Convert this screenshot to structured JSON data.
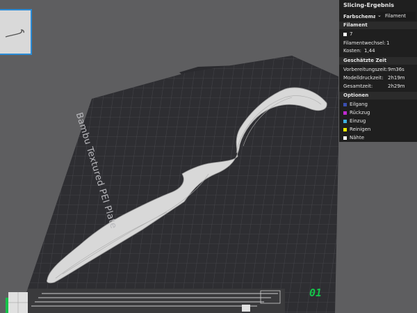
{
  "panel": {
    "title": "Slicing-Ergebnis",
    "scheme_label": "Farbschema",
    "scheme_value": "Filament",
    "filament_header": "Filament",
    "filament_number": "7",
    "filament_changes_label": "Filamentwechsel:",
    "filament_changes_value": "1",
    "cost_label": "Kosten:",
    "cost_value": "1,44",
    "time_header": "Geschätzte Zeit",
    "prep_label": "Vorbereitungszeit:",
    "prep_value": "9m36s",
    "model_label": "Modelldruckzeit:",
    "model_value": "2h19m",
    "total_label": "Gesamtzeit:",
    "total_value": "2h29m",
    "options_header": "Optionen",
    "options": [
      {
        "label": "Eilgang",
        "color": "#3a4fb0"
      },
      {
        "label": "Rückzug",
        "color": "#c02ad0"
      },
      {
        "label": "Einzug",
        "color": "#3fb0e0"
      },
      {
        "label": "Reinigen",
        "color": "#f0f000"
      },
      {
        "label": "Nähte",
        "color": "#ffffff"
      }
    ]
  },
  "plate_label": "Bambu Textured PEI Plate",
  "layer_number": "01"
}
